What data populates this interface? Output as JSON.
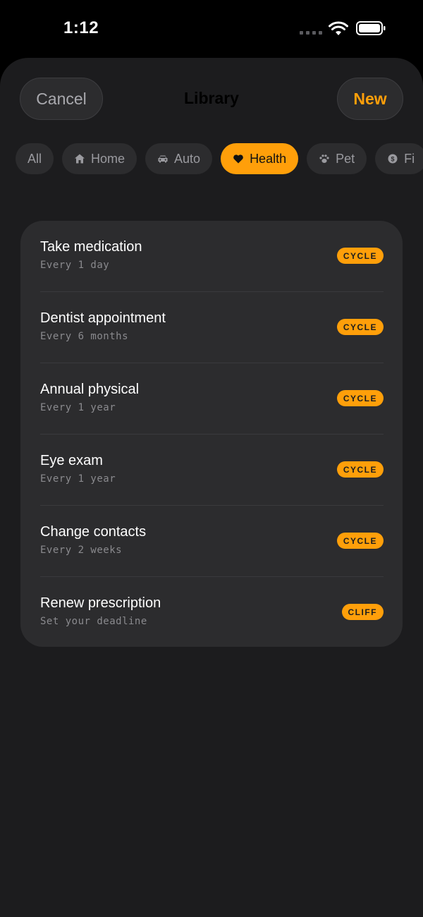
{
  "status_bar": {
    "time": "1:12"
  },
  "nav": {
    "cancel_label": "Cancel",
    "title": "Library",
    "new_label": "New"
  },
  "filters": [
    {
      "label": "All",
      "icon": "none",
      "active": false
    },
    {
      "label": "Home",
      "icon": "house-icon",
      "active": false
    },
    {
      "label": "Auto",
      "icon": "car-icon",
      "active": false
    },
    {
      "label": "Health",
      "icon": "heart-icon",
      "active": true
    },
    {
      "label": "Pet",
      "icon": "paw-icon",
      "active": false
    },
    {
      "label": "Fi",
      "icon": "dollar-icon",
      "active": false
    }
  ],
  "items": [
    {
      "title": "Take medication",
      "subtitle": "Every 1 day",
      "badge": "CYCLE"
    },
    {
      "title": "Dentist appointment",
      "subtitle": "Every 6 months",
      "badge": "CYCLE"
    },
    {
      "title": "Annual physical",
      "subtitle": "Every 1 year",
      "badge": "CYCLE"
    },
    {
      "title": "Eye exam",
      "subtitle": "Every 1 year",
      "badge": "CYCLE"
    },
    {
      "title": "Change contacts",
      "subtitle": "Every 2 weeks",
      "badge": "CYCLE"
    },
    {
      "title": "Renew prescription",
      "subtitle": "Set your deadline",
      "badge": "CLIFF"
    }
  ],
  "colors": {
    "accent": "#ff9f0a",
    "background": "#1c1c1e",
    "card": "#2c2c2e"
  }
}
